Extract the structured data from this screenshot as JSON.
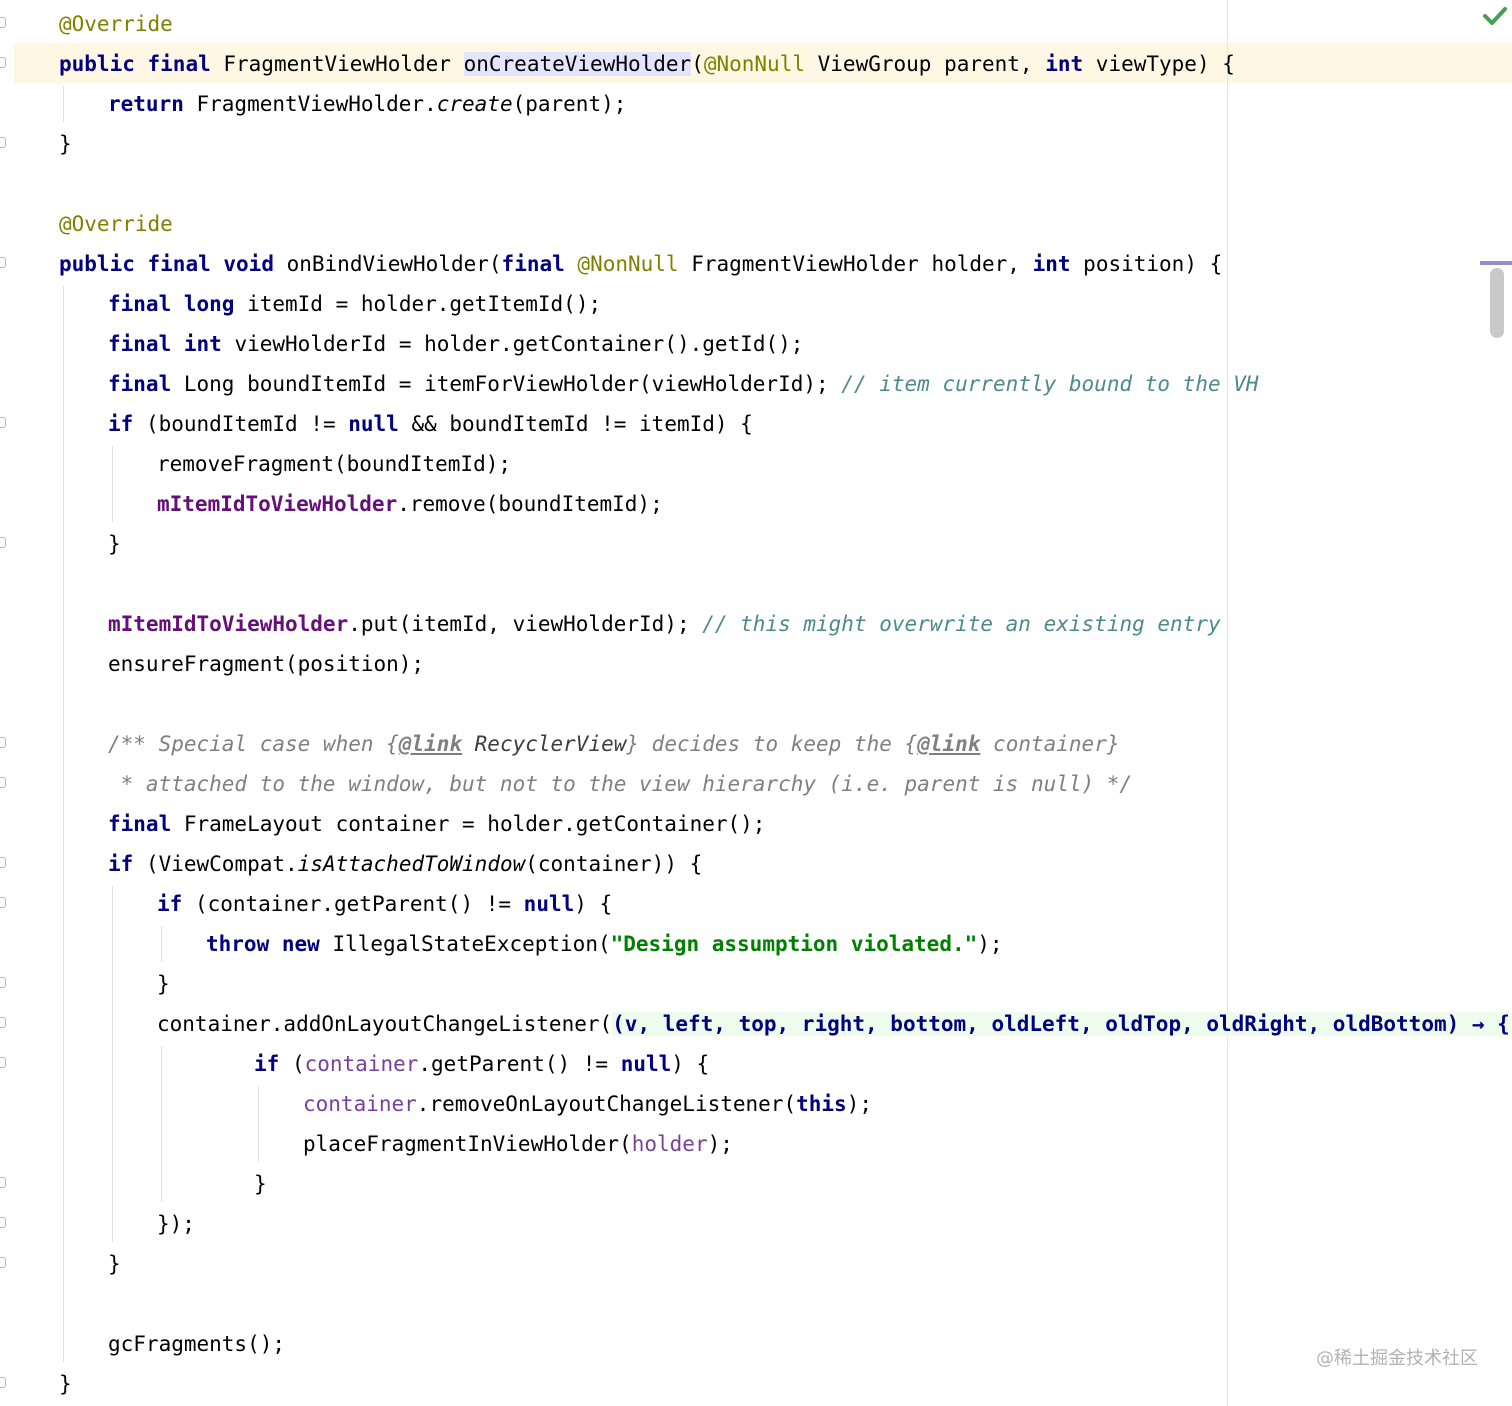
{
  "editor": {
    "language": "Java",
    "inspection_status_icon": "check-icon",
    "watermark": "@稀土掘金技术社区",
    "colors": {
      "keyword": "#000080",
      "annotation": "#808000",
      "field": "#660e7a",
      "comment": "#808080",
      "string": "#008000",
      "caret_row": "#fdf7e3",
      "usage_highlight": "#e4e4ff",
      "lambda_highlight": "#edfced",
      "status_ok": "#499c54"
    }
  },
  "code": {
    "l01": {
      "a": "@Override"
    },
    "l02": {
      "a": "public",
      "b": "final",
      "c": " FragmentViewHolder ",
      "d": "onCreateViewHolder",
      "e": "(",
      "f": "@NonNull",
      "g": " ViewGroup parent, ",
      "h": "int",
      "i": " viewType) {"
    },
    "l03": {
      "a": "return",
      "b": " FragmentViewHolder.",
      "c": "create",
      "d": "(parent);"
    },
    "l04": {
      "a": "}"
    },
    "l05": {
      "a": "@Override"
    },
    "l06": {
      "a": "public",
      "b": "final",
      "c": "void",
      "d": " onBindViewHolder(",
      "e": "final",
      "f": "@NonNull",
      "g": " FragmentViewHolder holder, ",
      "h": "int",
      "i": " position) {"
    },
    "l07": {
      "a": "final",
      "b": "long",
      "c": " itemId = holder.getItemId();"
    },
    "l08": {
      "a": "final",
      "b": "int",
      "c": " viewHolderId = holder.getContainer().getId();"
    },
    "l09": {
      "a": "final",
      "b": " Long boundItemId = itemForViewHolder(viewHolderId); ",
      "c": "// item currently bound to the VH"
    },
    "l10": {
      "a": "if",
      "b": " (boundItemId != ",
      "c": "null",
      "d": " && boundItemId != itemId) {"
    },
    "l11": {
      "a": "removeFragment(boundItemId);"
    },
    "l12": {
      "a": "mItemIdToViewHolder",
      "b": ".remove(boundItemId);"
    },
    "l13": {
      "a": "}"
    },
    "l14": {
      "a": "mItemIdToViewHolder",
      "b": ".put(itemId, viewHolderId); ",
      "c": "// this might overwrite an existing entry"
    },
    "l15": {
      "a": "ensureFragment(position);"
    },
    "l16": {
      "a": "/** Special case when {",
      "b": "@link",
      "c": " RecyclerView",
      "d": "} decides to keep the {",
      "e": "@link",
      "f": " container}"
    },
    "l17": {
      "a": " * attached to the window, but not to the view hierarchy (i.e. parent is null) */"
    },
    "l18": {
      "a": "final",
      "b": " FrameLayout container = holder.getContainer();"
    },
    "l19": {
      "a": "if",
      "b": " (ViewCompat.",
      "c": "isAttachedToWindow",
      "d": "(container)) {"
    },
    "l20": {
      "a": "if",
      "b": " (container.getParent() != ",
      "c": "null",
      "d": ") {"
    },
    "l21": {
      "a": "throw",
      "b": "new",
      "c": " IllegalStateException(",
      "d": "\"Design assumption violated.\"",
      "e": ");"
    },
    "l22": {
      "a": "}"
    },
    "l23": {
      "a": "container.addOnLayoutChangeListener(",
      "b": "(v, left, top, right, bottom, oldLeft, oldTop, oldRight, oldBottom) → {"
    },
    "l24": {
      "a": "if",
      "b": " (",
      "c": "container",
      "d": ".getParent() != ",
      "e": "null",
      "f": ") {"
    },
    "l25": {
      "a": "container",
      "b": ".removeOnLayoutChangeListener(",
      "c": "this",
      "d": ");"
    },
    "l26": {
      "a": "placeFragmentInViewHolder(",
      "b": "holder",
      "c": ");"
    },
    "l27": {
      "a": "}"
    },
    "l28": {
      "a": "});"
    },
    "l29": {
      "a": "}"
    },
    "l30": {
      "a": "gcFragments();"
    },
    "l31": {
      "a": "}"
    }
  }
}
